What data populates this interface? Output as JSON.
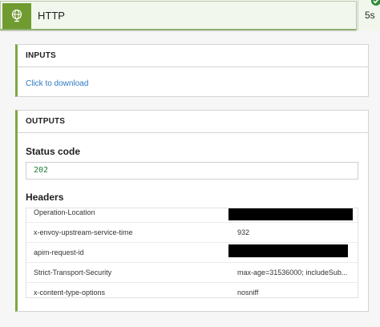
{
  "header": {
    "title": "HTTP",
    "duration": "5s",
    "icon": "globe-icon",
    "accent_color": "#709b31"
  },
  "inputs": {
    "section_title": "INPUTS",
    "download_link": "Click to download"
  },
  "outputs": {
    "section_title": "OUTPUTS",
    "status_label": "Status code",
    "status_value": "202",
    "headers_label": "Headers",
    "headers": [
      {
        "key": "Operation-Location",
        "value": "",
        "redacted": true
      },
      {
        "key": "x-envoy-upstream-service-time",
        "value": "932",
        "redacted": false
      },
      {
        "key": "apim-request-id",
        "value": "",
        "redacted": true
      },
      {
        "key": "Strict-Transport-Security",
        "value": "max-age=31536000; includeSub...",
        "redacted": false
      },
      {
        "key": "x-content-type-options",
        "value": "nosniff",
        "redacted": false
      }
    ]
  }
}
